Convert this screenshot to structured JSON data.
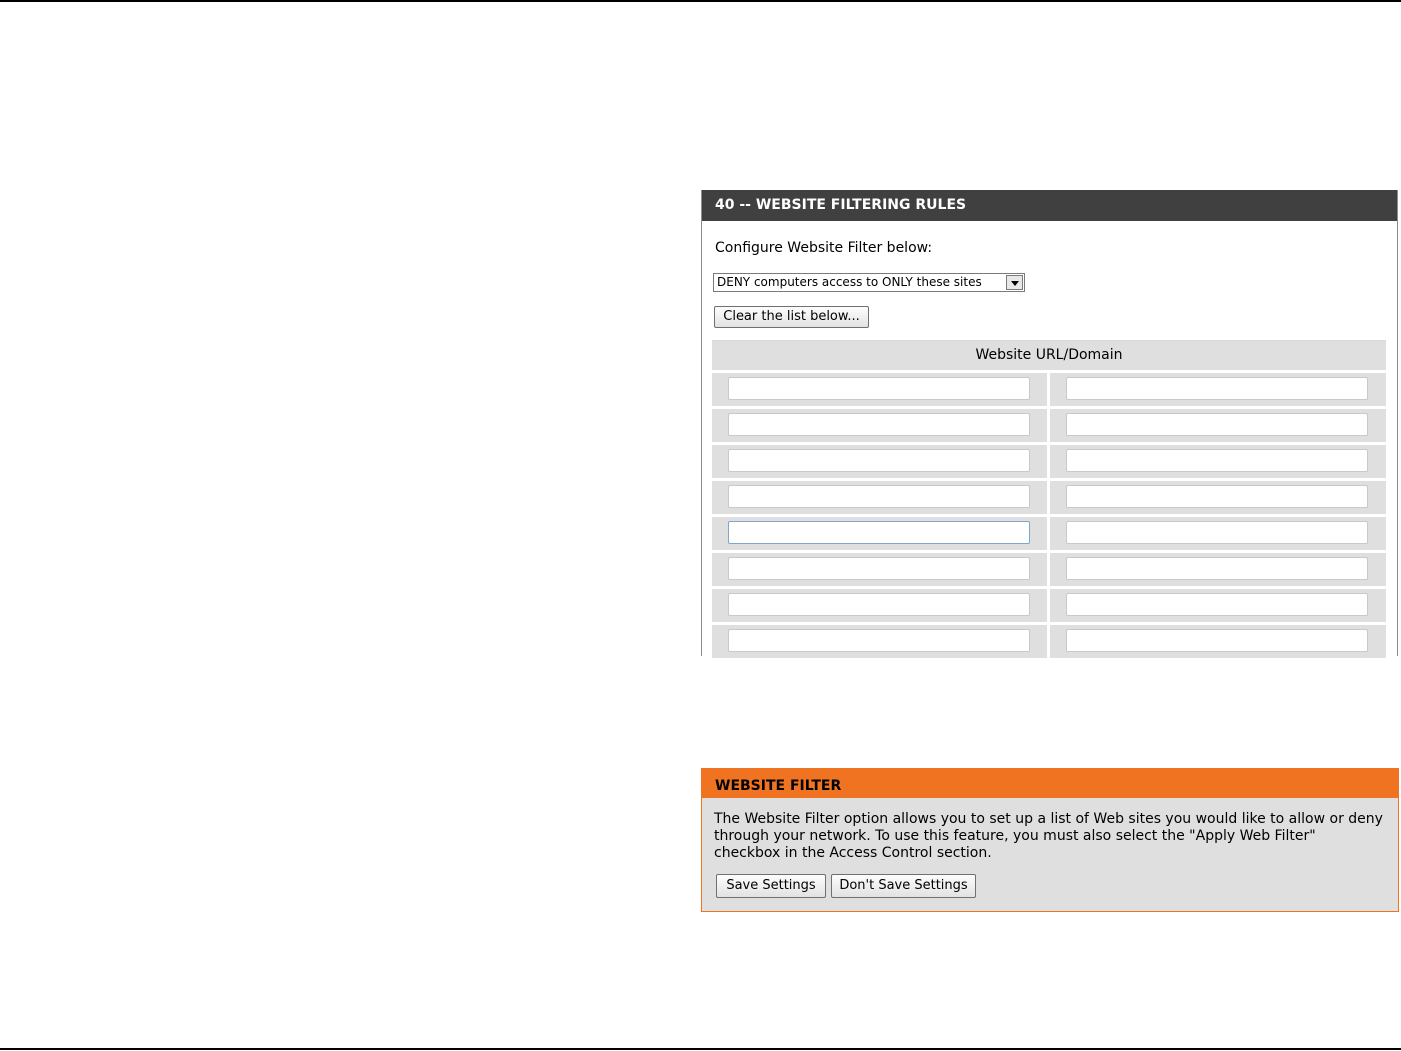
{
  "rules_panel": {
    "title": "40 -- WEBSITE FILTERING RULES",
    "config_label": "Configure Website Filter below:",
    "filter_mode": {
      "selected": "DENY computers access to ONLY these sites"
    },
    "clear_button_label": "Clear the list below...",
    "table_header": "Website URL/Domain",
    "rows": [
      [
        "",
        ""
      ],
      [
        "",
        ""
      ],
      [
        "",
        ""
      ],
      [
        "",
        ""
      ],
      [
        "",
        ""
      ],
      [
        "",
        ""
      ],
      [
        "",
        ""
      ],
      [
        "",
        ""
      ]
    ]
  },
  "help_panel": {
    "title": "WEBSITE FILTER",
    "description": "The Website Filter option allows you to set up a list of Web sites you would like to allow or deny through your network. To use this feature, you must also select the \"Apply Web Filter\" checkbox in the Access Control section.",
    "save_label": "Save Settings",
    "dont_save_label": "Don't Save Settings"
  },
  "colors": {
    "header_dark": "#404040",
    "header_orange": "#f07322",
    "table_gray": "#dfdfdf"
  }
}
